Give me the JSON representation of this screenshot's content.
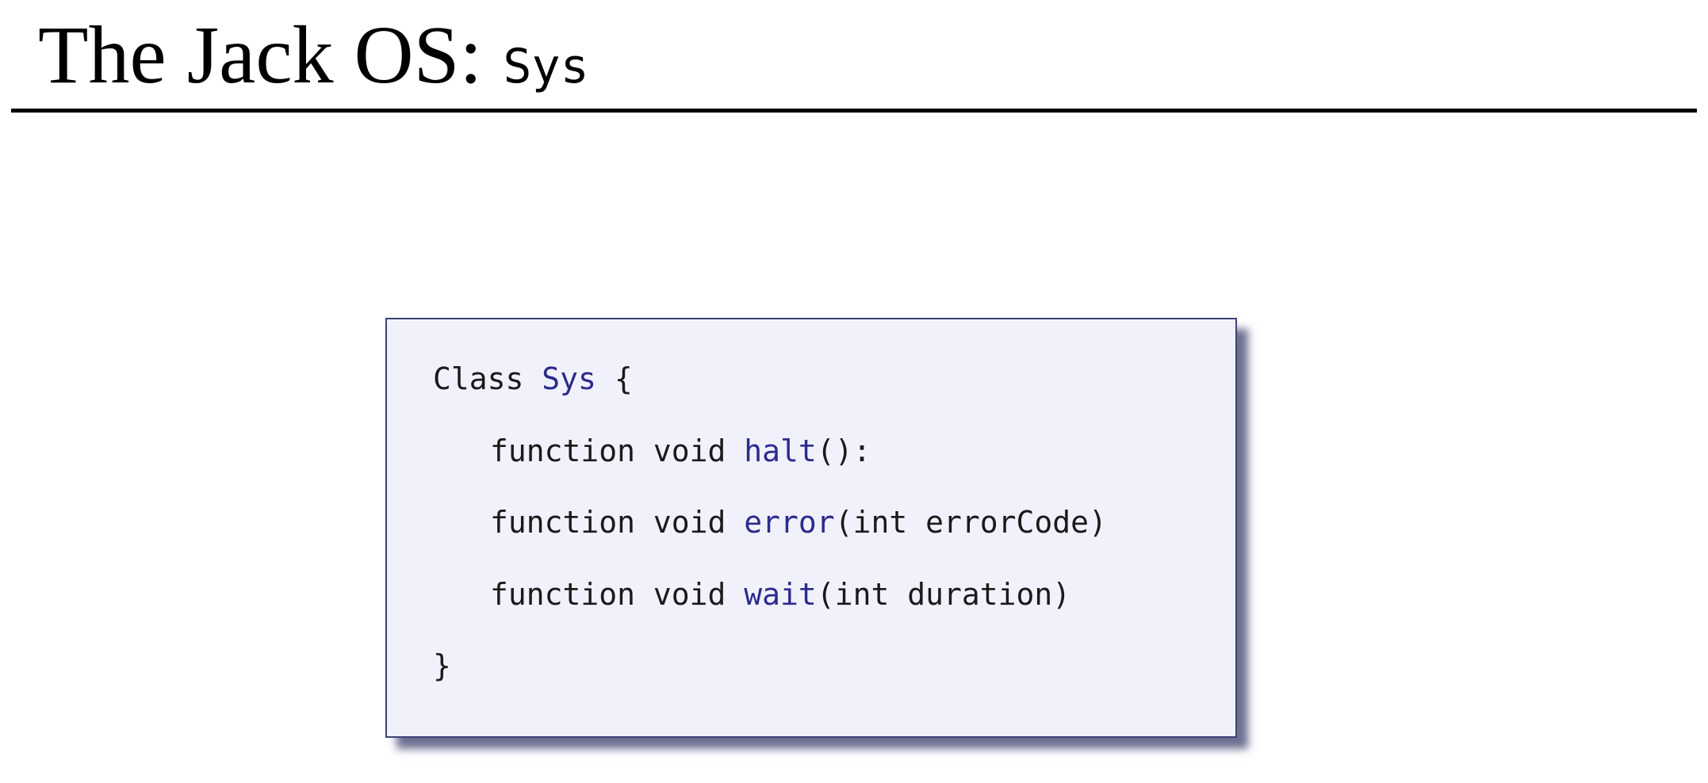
{
  "title": {
    "text": "The Jack OS: ",
    "code": "Sys"
  },
  "code_block": {
    "class_keyword": "Class",
    "class_name": "Sys",
    "open_brace": "{",
    "methods": [
      {
        "signature_prefix": "function void ",
        "name": "halt",
        "params": "():"
      },
      {
        "signature_prefix": "function void ",
        "name": "error",
        "params": "(int errorCode)"
      },
      {
        "signature_prefix": "function void ",
        "name": "wait",
        "params": "(int duration)"
      }
    ],
    "close_brace": "}"
  },
  "colors": {
    "identifier": "#2b2b8c",
    "code_text": "#1a1a1a",
    "box_background": "#f1f1fc",
    "box_border": "#3e4277"
  }
}
